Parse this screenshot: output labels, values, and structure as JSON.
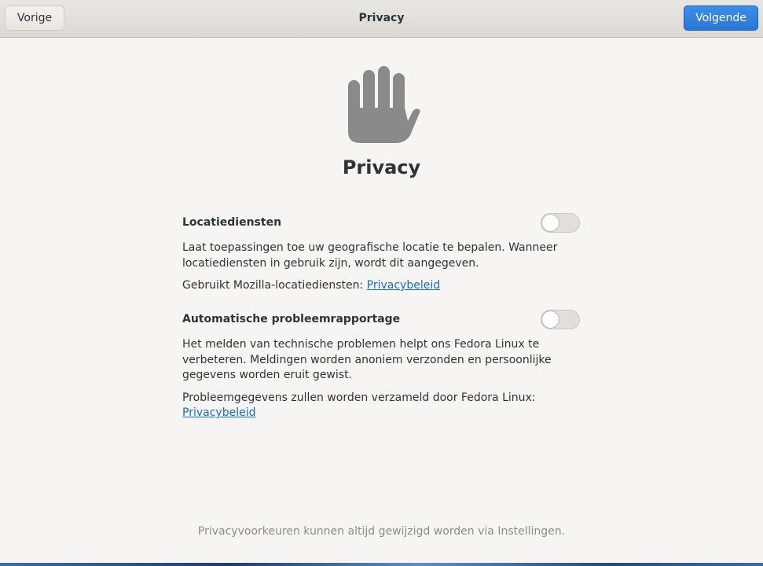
{
  "header": {
    "back_label": "Vorige",
    "title": "Privacy",
    "next_label": "Volgende"
  },
  "page": {
    "icon": "hand-stop-icon",
    "title": "Privacy"
  },
  "location": {
    "title": "Locatiediensten",
    "description": "Laat toepassingen toe uw geografische locatie te bepalen. Wanneer locatiediensten in gebruik zijn, wordt dit aangegeven.",
    "note": "Gebruikt Mozilla-locatiediensten: ",
    "link": "Privacybeleid",
    "enabled": false
  },
  "problem_reporting": {
    "title": "Automatische probleemrapportage",
    "description": "Het melden van technische problemen helpt ons Fedora Linux te verbeteren. Meldingen worden anoniem verzonden en persoonlijke gegevens worden eruit gewist.",
    "note": "Probleemgegevens zullen worden verzameld door Fedora Linux: ",
    "link": "Privacybeleid",
    "enabled": false
  },
  "footer": {
    "text": "Privacyvoorkeuren kunnen altijd gewijzigd worden via Instellingen."
  },
  "colors": {
    "accent": "#2a76d6",
    "background": "#f6f5f4",
    "icon": "#8a8a8a",
    "link": "#1b6acb"
  }
}
